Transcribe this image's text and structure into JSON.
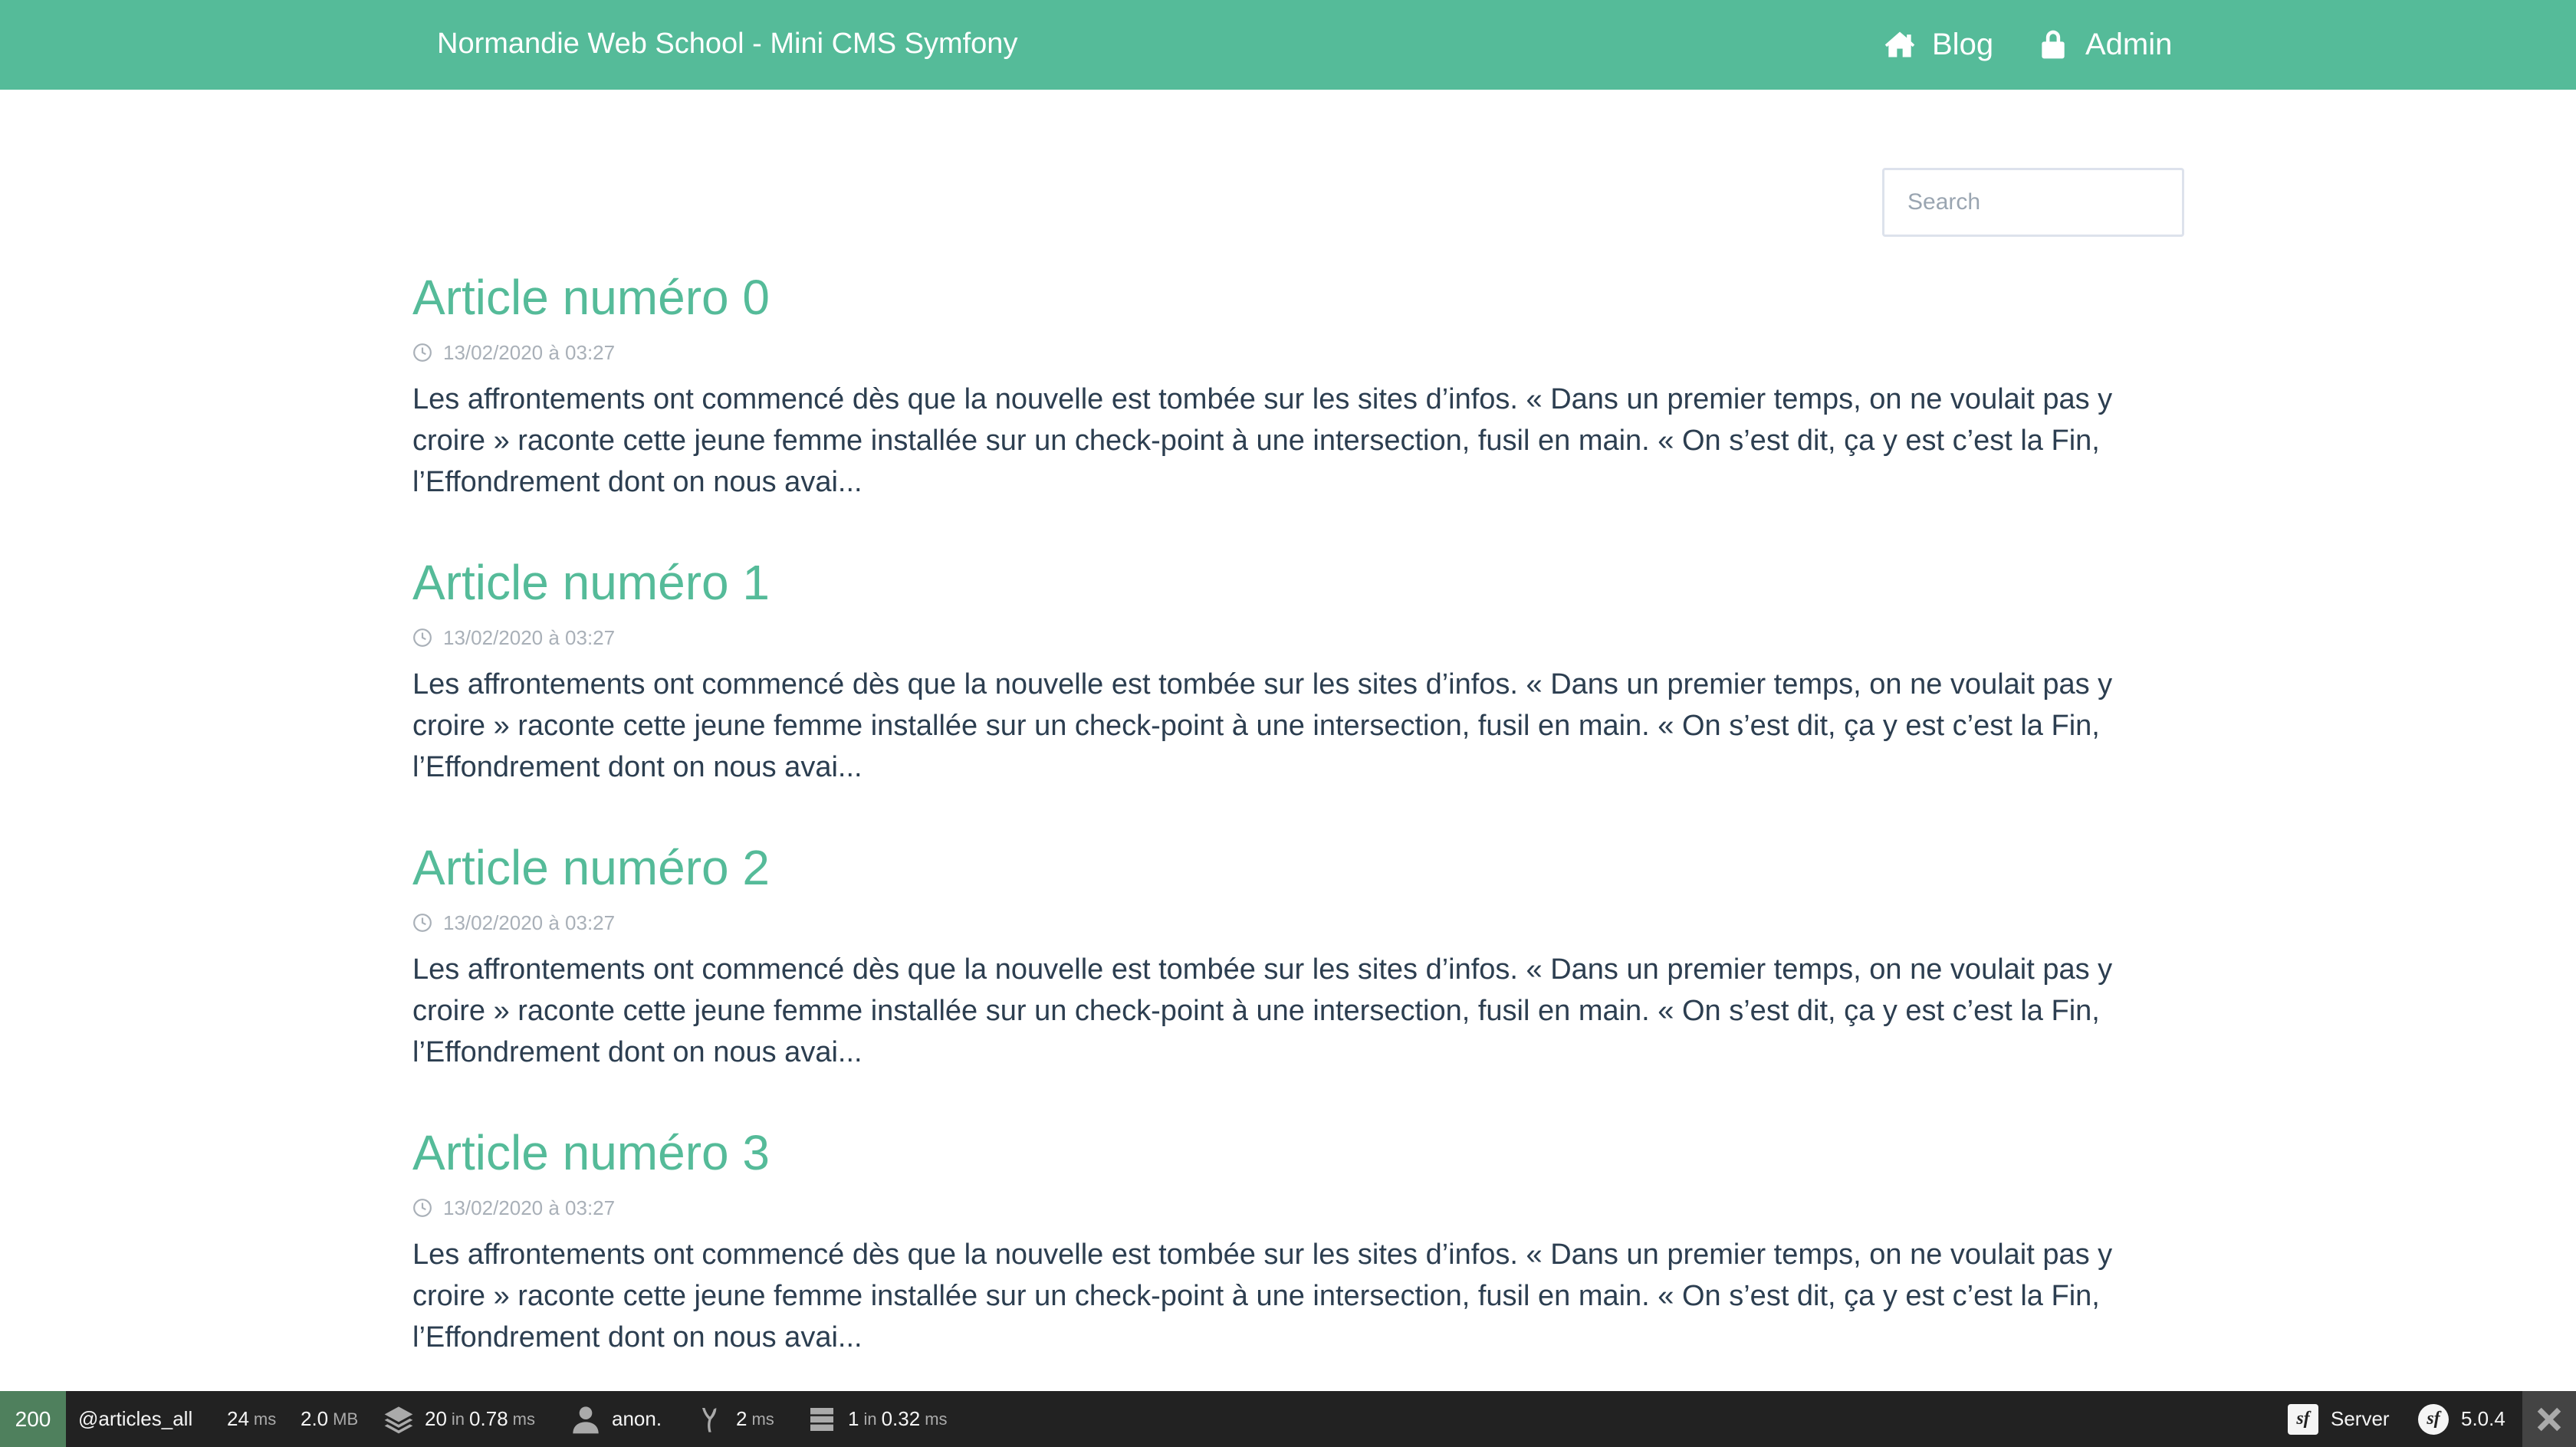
{
  "navbar": {
    "brand": "Normandie Web School - Mini CMS Symfony",
    "links": [
      {
        "label": "Blog",
        "icon": "home-icon"
      },
      {
        "label": "Admin",
        "icon": "lock-icon"
      }
    ]
  },
  "search": {
    "placeholder": "Search",
    "value": ""
  },
  "articles": [
    {
      "title": "Article numéro 0",
      "date": "13/02/2020 à 03:27",
      "excerpt": "Les affrontements ont commencé dès que la nouvelle est tombée sur les sites d’infos. « Dans un premier temps, on ne voulait pas y croire » raconte cette jeune femme installée sur un check-point à une intersection, fusil en main. « On s’est dit, ça y est c’est la Fin, l’Effondrement dont on nous avai..."
    },
    {
      "title": "Article numéro 1",
      "date": "13/02/2020 à 03:27",
      "excerpt": "Les affrontements ont commencé dès que la nouvelle est tombée sur les sites d’infos. « Dans un premier temps, on ne voulait pas y croire » raconte cette jeune femme installée sur un check-point à une intersection, fusil en main. « On s’est dit, ça y est c’est la Fin, l’Effondrement dont on nous avai..."
    },
    {
      "title": "Article numéro 2",
      "date": "13/02/2020 à 03:27",
      "excerpt": "Les affrontements ont commencé dès que la nouvelle est tombée sur les sites d’infos. « Dans un premier temps, on ne voulait pas y croire » raconte cette jeune femme installée sur un check-point à une intersection, fusil en main. « On s’est dit, ça y est c’est la Fin, l’Effondrement dont on nous avai..."
    },
    {
      "title": "Article numéro 3",
      "date": "13/02/2020 à 03:27",
      "excerpt": "Les affrontements ont commencé dès que la nouvelle est tombée sur les sites d’infos. « Dans un premier temps, on ne voulait pas y croire » raconte cette jeune femme installée sur un check-point à une intersection, fusil en main. « On s’est dit, ça y est c’est la Fin, l’Effondrement dont on nous avai..."
    }
  ],
  "toolbar": {
    "status_code": "200",
    "route": "articles_all",
    "route_prefix": "@",
    "time_value": "24",
    "time_unit": "ms",
    "memory_value": "2.0",
    "memory_unit": "MB",
    "cache_value": "20",
    "cache_in": "in",
    "cache_time": "0.78",
    "cache_unit": "ms",
    "user": "anon.",
    "twig_value": "2",
    "twig_unit": "ms",
    "db_value": "1",
    "db_in": "in",
    "db_time": "0.32",
    "db_unit": "ms",
    "server_label": "Server",
    "version": "5.0.4"
  },
  "colors": {
    "accent": "#55bb99",
    "text": "#2c3e50",
    "meta": "#a9b0b8",
    "toolbar_bg": "#222222",
    "status_ok": "#4f805d"
  }
}
